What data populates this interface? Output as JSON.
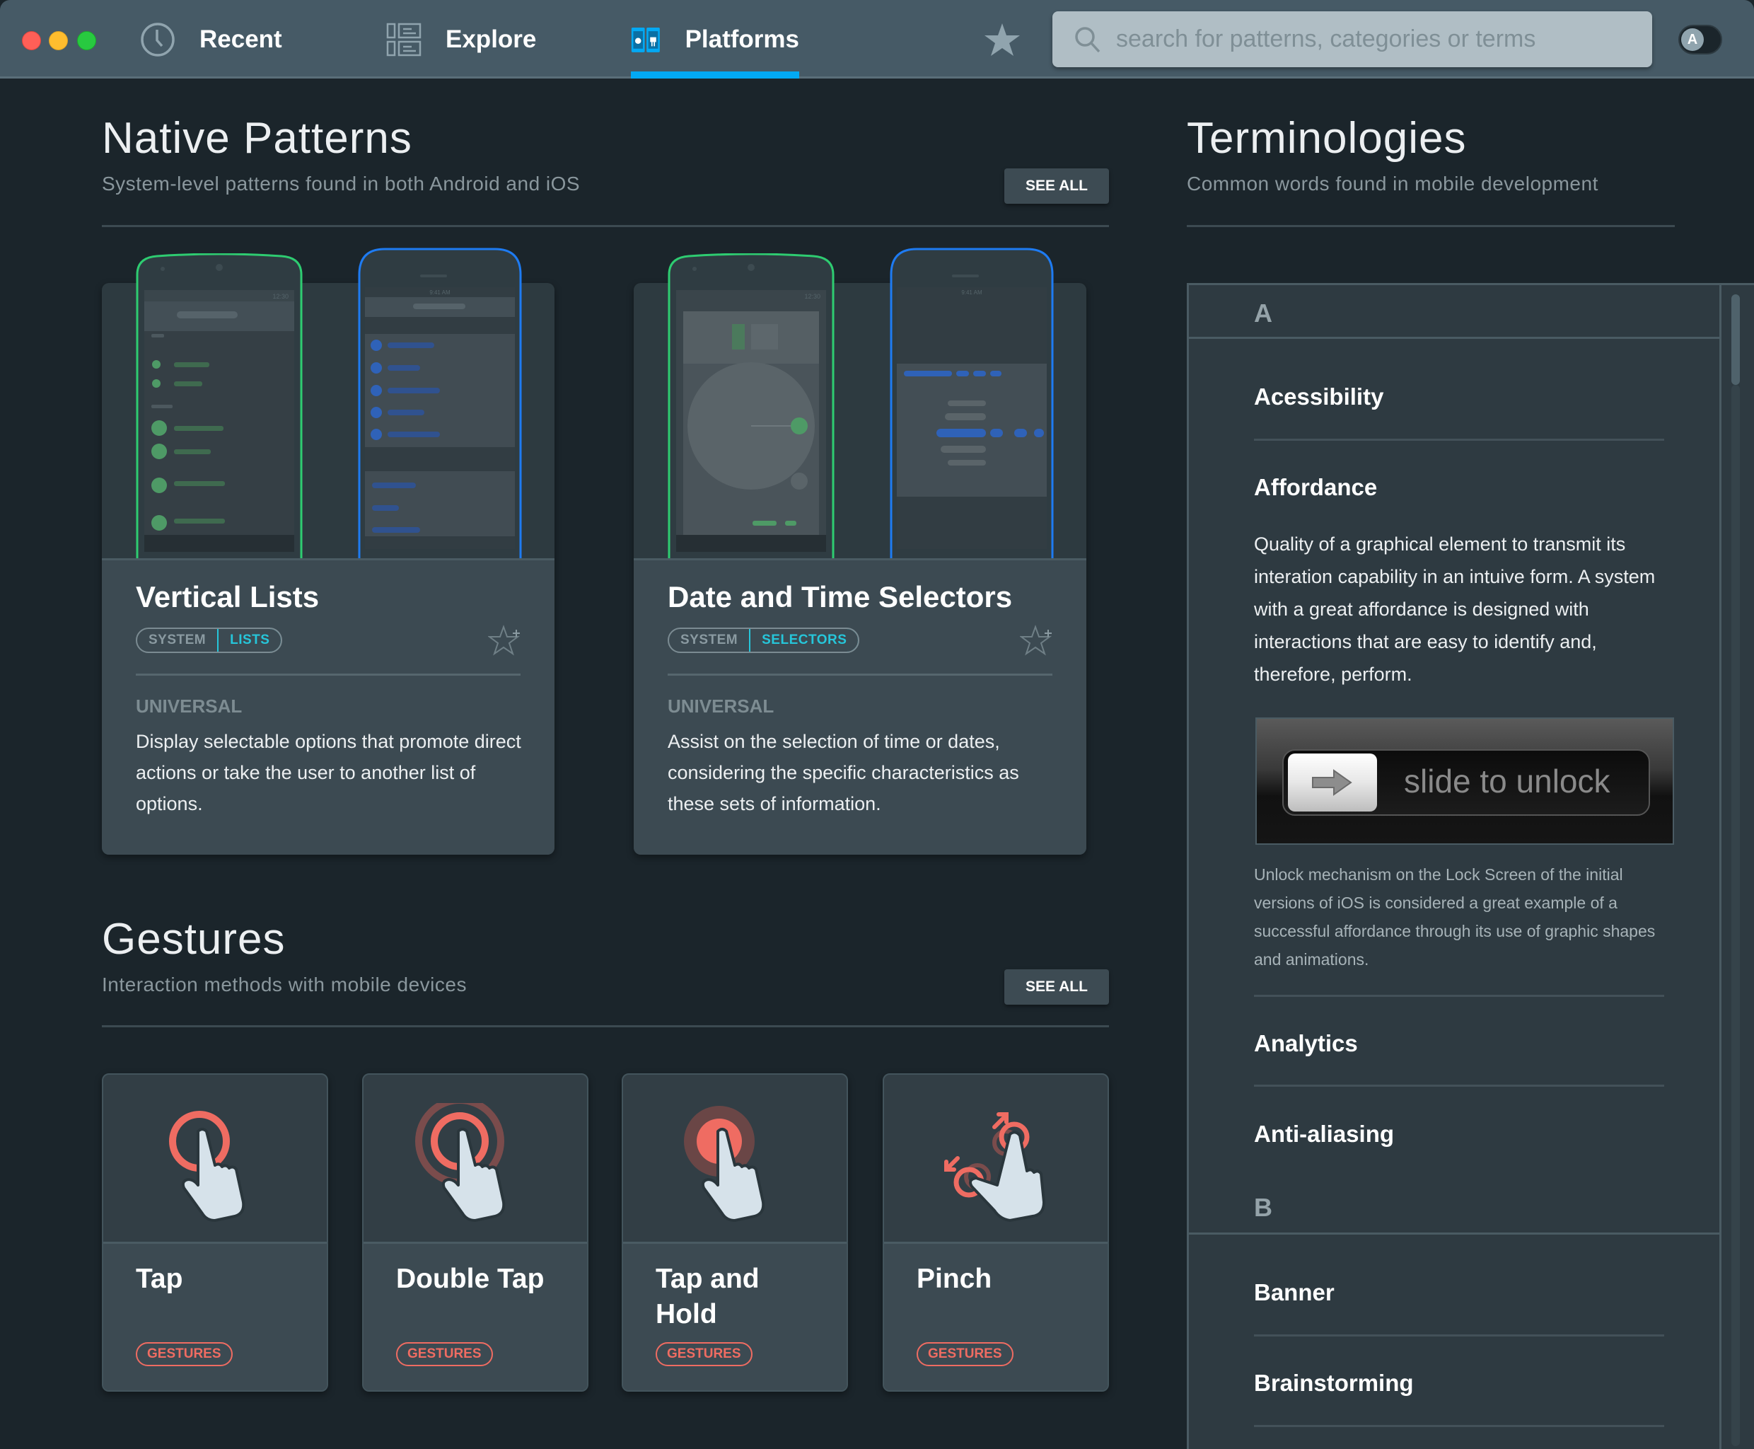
{
  "window": {
    "traffic_lights": {
      "close": "#ff5f57",
      "minimize": "#ffbd2e",
      "zoom": "#28c940"
    }
  },
  "nav": {
    "tabs": [
      {
        "label": "Recent",
        "icon": "clock-icon",
        "active": false
      },
      {
        "label": "Explore",
        "icon": "explore-grid-icon",
        "active": false
      },
      {
        "label": "Platforms",
        "icon": "platforms-phones-icon",
        "active": true
      }
    ],
    "favorites_icon": "star-icon",
    "search": {
      "placeholder": "search for patterns, categories or terms",
      "value": ""
    },
    "account_toggle_letter": "A",
    "accent_color": "#03a9f4"
  },
  "native_patterns": {
    "title": "Native Patterns",
    "subtitle": "System-level patterns found in both Android and iOS",
    "see_all": "SEE ALL",
    "cards": [
      {
        "title": "Vertical Lists",
        "tags": [
          "SYSTEM",
          "LISTS"
        ],
        "kind": "UNIVERSAL",
        "description": "Display selectable options that promote direct actions or take the user to another list of options.",
        "android_status_time": "12:30",
        "ios_status_time": "9:41 AM"
      },
      {
        "title": "Date and Time Selectors",
        "tags": [
          "SYSTEM",
          "SELECTORS"
        ],
        "kind": "UNIVERSAL",
        "description": "Assist on the selection of time or dates, considering the specific characteristics as these sets of information.",
        "android_status_time": "12:30",
        "ios_status_time": "9:41 AM"
      }
    ]
  },
  "gestures": {
    "title": "Gestures",
    "subtitle": "Interaction methods with mobile devices",
    "see_all": "SEE ALL",
    "cards": [
      {
        "title": "Tap",
        "tag": "GESTURES",
        "icon": "tap-gesture-icon"
      },
      {
        "title": "Double Tap",
        "tag": "GESTURES",
        "icon": "double-tap-gesture-icon"
      },
      {
        "title": "Tap and Hold",
        "tag": "GESTURES",
        "icon": "tap-hold-gesture-icon"
      },
      {
        "title": "Pinch",
        "tag": "GESTURES",
        "icon": "pinch-gesture-icon"
      }
    ],
    "accent_color": "#ef6c62"
  },
  "terminologies": {
    "title": "Terminologies",
    "subtitle": "Common words found in mobile development",
    "groups": [
      {
        "letter": "A",
        "terms": [
          {
            "name": "Acessibility"
          },
          {
            "name": "Affordance",
            "description": "Quality of a graphical element to transmit its interation capability in an intuive form. A system with a great affordance is designed with interactions that are easy to identify and, therefore, perform.",
            "image_text": "slide to unlock",
            "caption": "Unlock mechanism on the Lock Screen of the initial versions of iOS is considered a great example of a successful affordance through its use of graphic shapes and animations."
          },
          {
            "name": "Analytics"
          },
          {
            "name": "Anti-aliasing"
          }
        ]
      },
      {
        "letter": "B",
        "terms": [
          {
            "name": "Banner"
          },
          {
            "name": "Brainstorming"
          }
        ]
      }
    ]
  }
}
